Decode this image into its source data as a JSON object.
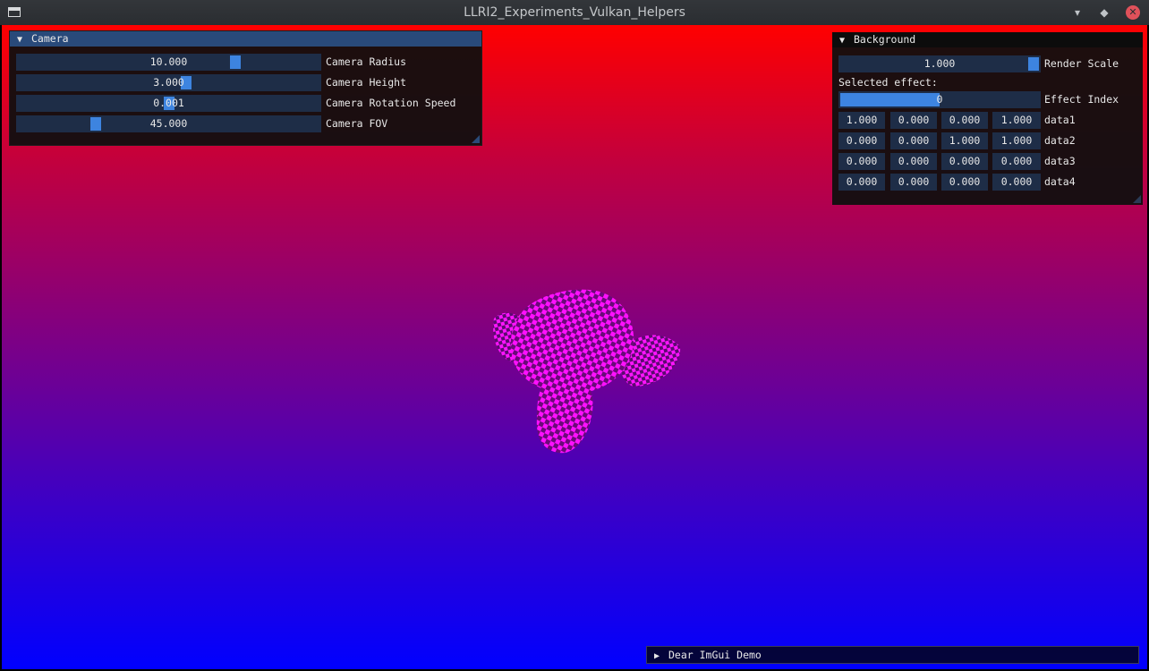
{
  "window": {
    "title": "LLRI2_Experiments_Vulkan_Helpers",
    "minimize_glyph": "▾",
    "maximize_glyph": "◆",
    "close_glyph": "✕"
  },
  "scene": {
    "mesh": "checkered monkey head",
    "mesh_color": "#ff00ff"
  },
  "camera_window": {
    "title": "Camera",
    "arrow": "▼",
    "sliders": [
      {
        "label": "Camera Radius",
        "value": "10.000",
        "fraction": 0.73
      },
      {
        "label": "Camera Height",
        "value": "3.000",
        "fraction": 0.56
      },
      {
        "label": "Camera Rotation Speed",
        "value": "0.001",
        "fraction": 0.5
      },
      {
        "label": "Camera FOV",
        "value": "45.000",
        "fraction": 0.25
      }
    ]
  },
  "background_window": {
    "title": "Background",
    "arrow": "▼",
    "render_scale": {
      "label": "Render Scale",
      "value": "1.000",
      "fraction": 1.0
    },
    "selected_effect_label": "Selected effect:",
    "effect_index": {
      "label": "Effect Index",
      "value": "0",
      "fraction": 0.5
    },
    "data_rows": [
      {
        "label": "data1",
        "values": [
          "1.000",
          "0.000",
          "0.000",
          "1.000"
        ]
      },
      {
        "label": "data2",
        "values": [
          "0.000",
          "0.000",
          "1.000",
          "1.000"
        ]
      },
      {
        "label": "data3",
        "values": [
          "0.000",
          "0.000",
          "0.000",
          "0.000"
        ]
      },
      {
        "label": "data4",
        "values": [
          "0.000",
          "0.000",
          "0.000",
          "0.000"
        ]
      }
    ]
  },
  "demo_window": {
    "title": "Dear ImGui Demo",
    "arrow": "▶"
  },
  "colors": {
    "frame_bg": "#1e2d47",
    "slider_grab": "#3d84e0",
    "title_active": "#294a7a",
    "window_bg": "#0f0f0f"
  }
}
